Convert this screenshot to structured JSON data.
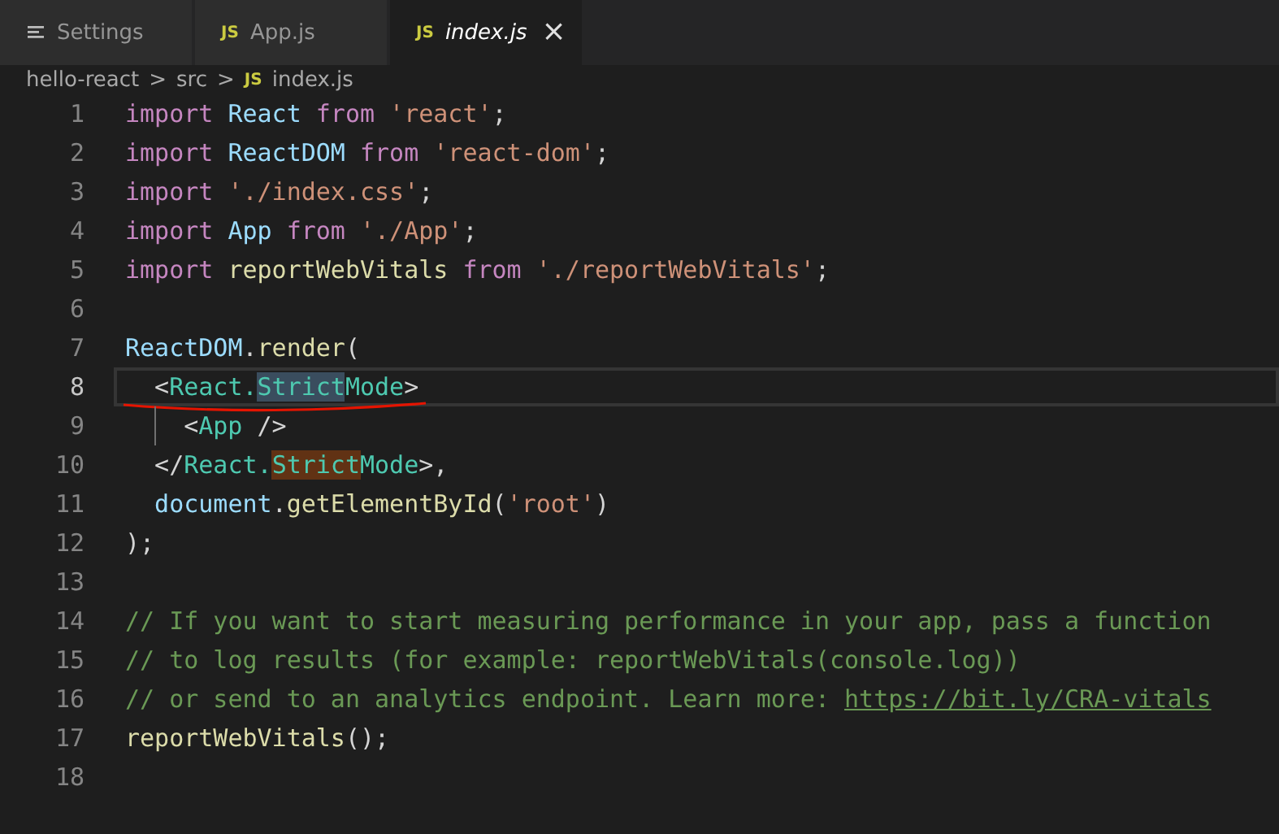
{
  "tabs": [
    {
      "label": "Settings",
      "kind": "settings",
      "selected": false,
      "preview": false
    },
    {
      "label": "App.js",
      "kind": "file",
      "badge": "JS",
      "selected": false,
      "preview": false
    },
    {
      "label": "index.js",
      "kind": "file",
      "badge": "JS",
      "selected": true,
      "preview": true,
      "close": "×"
    }
  ],
  "breadcrumb": [
    {
      "label": "hello-react"
    },
    {
      "label": "src"
    },
    {
      "label": "index.js",
      "badge": "JS"
    }
  ],
  "breadcrumb_separator": ">",
  "lines": [
    {
      "number": "1",
      "current": false,
      "guide": false,
      "underlined": false,
      "tokens": [
        {
          "kind": "kw",
          "text": "import"
        },
        {
          "kind": "var",
          "text": " React "
        },
        {
          "kind": "kw",
          "text": "from"
        },
        {
          "kind": "str",
          "text": " 'react'"
        },
        {
          "kind": "punc",
          "text": ";"
        }
      ]
    },
    {
      "number": "2",
      "current": false,
      "guide": false,
      "underlined": false,
      "tokens": [
        {
          "kind": "kw",
          "text": "import"
        },
        {
          "kind": "var",
          "text": " ReactDOM "
        },
        {
          "kind": "kw",
          "text": "from"
        },
        {
          "kind": "str",
          "text": " 'react-dom'"
        },
        {
          "kind": "punc",
          "text": ";"
        }
      ]
    },
    {
      "number": "3",
      "current": false,
      "guide": false,
      "underlined": false,
      "tokens": [
        {
          "kind": "kw",
          "text": "import"
        },
        {
          "kind": "str",
          "text": " './index.css'"
        },
        {
          "kind": "punc",
          "text": ";"
        }
      ]
    },
    {
      "number": "4",
      "current": false,
      "guide": false,
      "underlined": false,
      "tokens": [
        {
          "kind": "kw",
          "text": "import"
        },
        {
          "kind": "var",
          "text": " App "
        },
        {
          "kind": "kw",
          "text": "from"
        },
        {
          "kind": "str",
          "text": " './App'"
        },
        {
          "kind": "punc",
          "text": ";"
        }
      ]
    },
    {
      "number": "5",
      "current": false,
      "guide": false,
      "underlined": false,
      "tokens": [
        {
          "kind": "kw",
          "text": "import"
        },
        {
          "kind": "fn",
          "text": " reportWebVitals "
        },
        {
          "kind": "kw",
          "text": "from"
        },
        {
          "kind": "str",
          "text": " './reportWebVitals'"
        },
        {
          "kind": "punc",
          "text": ";"
        }
      ]
    },
    {
      "number": "6",
      "current": false,
      "guide": false,
      "underlined": false
    },
    {
      "number": "7",
      "current": false,
      "guide": false,
      "underlined": false,
      "tokens": [
        {
          "kind": "var",
          "text": "ReactDOM"
        },
        {
          "kind": "punc",
          "text": "."
        },
        {
          "kind": "fn",
          "text": "render"
        },
        {
          "kind": "punc",
          "text": "("
        }
      ]
    },
    {
      "number": "8",
      "current": true,
      "guide": false,
      "underlined": true,
      "tokens": [
        {
          "kind": "punc",
          "text": "  <"
        },
        {
          "kind": "tag",
          "text": "React."
        },
        {
          "kind": "tag-selection",
          "text": "Strict"
        },
        {
          "kind": "tag",
          "text": "Mode"
        },
        {
          "kind": "punc",
          "text": ">"
        }
      ]
    },
    {
      "number": "9",
      "current": false,
      "guide": true,
      "underlined": false,
      "tokens": [
        {
          "kind": "punc",
          "text": "<"
        },
        {
          "kind": "tag",
          "text": "App"
        },
        {
          "kind": "punc",
          "text": " />"
        }
      ]
    },
    {
      "number": "10",
      "current": false,
      "guide": false,
      "underlined": false,
      "tokens": [
        {
          "kind": "punc",
          "text": "  </"
        },
        {
          "kind": "tag",
          "text": "React."
        },
        {
          "kind": "tag-match",
          "text": "Strict"
        },
        {
          "kind": "tag",
          "text": "Mode"
        },
        {
          "kind": "punc",
          "text": ">,"
        }
      ]
    },
    {
      "number": "11",
      "current": false,
      "guide": false,
      "underlined": false,
      "tokens": [
        {
          "kind": "var",
          "text": "  document"
        },
        {
          "kind": "punc",
          "text": "."
        },
        {
          "kind": "fn",
          "text": "getElementById"
        },
        {
          "kind": "punc",
          "text": "("
        },
        {
          "kind": "str",
          "text": "'root'"
        },
        {
          "kind": "punc",
          "text": ")"
        }
      ]
    },
    {
      "number": "12",
      "current": false,
      "guide": false,
      "underlined": false,
      "tokens": [
        {
          "kind": "punc",
          "text": ");"
        }
      ]
    },
    {
      "number": "13",
      "current": false,
      "guide": false,
      "underlined": false
    },
    {
      "number": "14",
      "current": false,
      "guide": false,
      "underlined": false,
      "tokens": [
        {
          "kind": "comment",
          "text": "// If you want to start measuring performance in your app, pass a function"
        }
      ]
    },
    {
      "number": "15",
      "current": false,
      "guide": false,
      "underlined": false,
      "tokens": [
        {
          "kind": "comment",
          "text": "// to log results (for example: reportWebVitals(console.log))"
        }
      ]
    },
    {
      "number": "16",
      "current": false,
      "guide": false,
      "underlined": false,
      "tokens": [
        {
          "kind": "comment",
          "text": "// or send to an analytics endpoint. Learn more: "
        },
        {
          "kind": "link",
          "text": "https://bit.ly/CRA-vitals"
        }
      ]
    },
    {
      "number": "17",
      "current": false,
      "guide": false,
      "underlined": false,
      "tokens": [
        {
          "kind": "fn",
          "text": "reportWebVitals"
        },
        {
          "kind": "punc",
          "text": "();"
        }
      ]
    },
    {
      "number": "18",
      "current": false,
      "guide": false,
      "underlined": false
    }
  ]
}
